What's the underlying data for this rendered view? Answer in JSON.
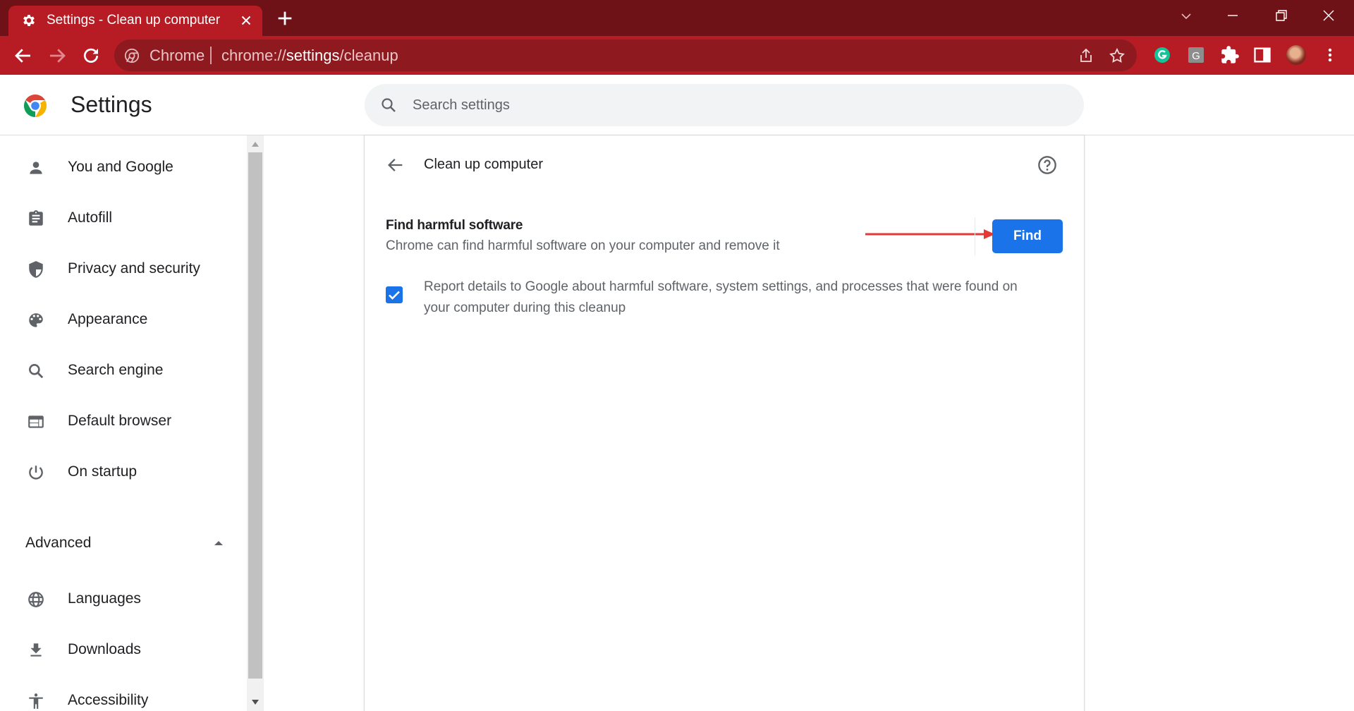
{
  "tab": {
    "title": "Settings - Clean up computer"
  },
  "omnibox": {
    "site_label": "Chrome",
    "url_prefix": "chrome://",
    "url_host": "settings",
    "url_path": "/cleanup"
  },
  "header": {
    "brand": "Settings"
  },
  "search": {
    "placeholder": "Search settings"
  },
  "sidebar": {
    "items": [
      {
        "label": "You and Google",
        "icon": "person-icon"
      },
      {
        "label": "Autofill",
        "icon": "clipboard-icon"
      },
      {
        "label": "Privacy and security",
        "icon": "shield-icon"
      },
      {
        "label": "Appearance",
        "icon": "palette-icon"
      },
      {
        "label": "Search engine",
        "icon": "search-icon"
      },
      {
        "label": "Default browser",
        "icon": "browser-icon"
      },
      {
        "label": "On startup",
        "icon": "power-icon"
      }
    ],
    "advanced_label": "Advanced",
    "advanced_items": [
      {
        "label": "Languages",
        "icon": "globe-icon"
      },
      {
        "label": "Downloads",
        "icon": "download-icon"
      },
      {
        "label": "Accessibility",
        "icon": "accessibility-icon"
      }
    ]
  },
  "main": {
    "page_title": "Clean up computer",
    "row_title": "Find harmful software",
    "row_subtitle": "Chrome can find harmful software on your computer and remove it",
    "find_label": "Find",
    "report_checked": true,
    "report_text": "Report details to Google about harmful software, system settings, and processes that were found on your computer during this cleanup"
  },
  "colors": {
    "tab_strip": "#6e1217",
    "toolbar": "#b71c24",
    "accent": "#1a73e8",
    "annotation_arrow": "#e53935"
  }
}
